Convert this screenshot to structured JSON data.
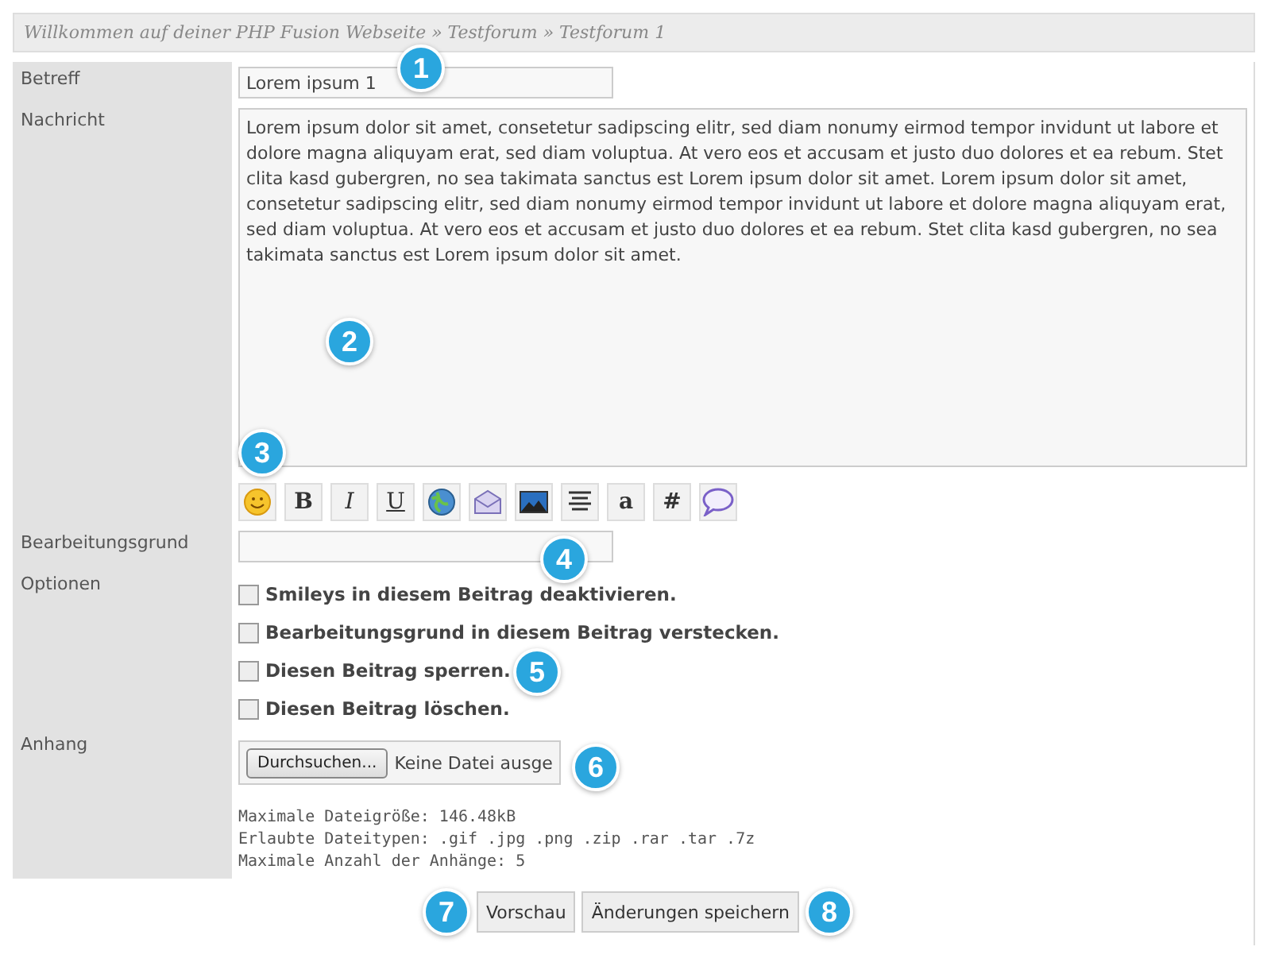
{
  "breadcrumb": "Willkommen auf deiner PHP Fusion Webseite » Testforum » Testforum 1",
  "subject": {
    "label": "Betreff",
    "value": "Lorem ipsum 1"
  },
  "message": {
    "label": "Nachricht",
    "value": "Lorem ipsum dolor sit amet, consetetur sadipscing elitr, sed diam nonumy eirmod tempor invidunt ut labore et dolore magna aliquyam erat, sed diam voluptua. At vero eos et accusam et justo duo dolores et ea rebum. Stet clita kasd gubergren, no sea takimata sanctus est Lorem ipsum dolor sit amet. Lorem ipsum dolor sit amet, consetetur sadipscing elitr, sed diam nonumy eirmod tempor invidunt ut labore et dolore magna aliquyam erat, sed diam voluptua. At vero eos et accusam et justo duo dolores et ea rebum. Stet clita kasd gubergren, no sea takimata sanctus est Lorem ipsum dolor sit amet."
  },
  "toolbar": [
    {
      "kind": "smiley"
    },
    {
      "kind": "bold",
      "label": "B"
    },
    {
      "kind": "italic",
      "label": "I"
    },
    {
      "kind": "underline",
      "label": "U"
    },
    {
      "kind": "globe"
    },
    {
      "kind": "mail"
    },
    {
      "kind": "image"
    },
    {
      "kind": "align"
    },
    {
      "kind": "glyph",
      "label": "a"
    },
    {
      "kind": "glyph",
      "label": "#"
    },
    {
      "kind": "bubble"
    }
  ],
  "edit_reason": {
    "label": "Bearbeitungsgrund"
  },
  "options": {
    "label": "Optionen",
    "items": [
      {
        "label": "Smileys in diesem Beitrag deaktivieren.",
        "checked": false
      },
      {
        "label": "Bearbeitungsgrund in diesem Beitrag verstecken.",
        "checked": false
      },
      {
        "label": "Diesen Beitrag sperren.",
        "checked": false
      },
      {
        "label": "Diesen Beitrag löschen.",
        "checked": false
      }
    ]
  },
  "attachment": {
    "label": "Anhang",
    "browse_button": "Durchsuchen...",
    "file_status": "Keine Datei ausge",
    "info": [
      "Maximale Dateigröße: 146.48kB",
      "Erlaubte Dateitypen: .gif .jpg .png .zip .rar .tar .7z",
      "Maximale Anzahl der Anhänge: 5"
    ]
  },
  "buttons": [
    "Vorschau",
    "Änderungen speichern"
  ],
  "callouts": [
    "1",
    "2",
    "3",
    "4",
    "5",
    "6",
    "7",
    "8"
  ]
}
